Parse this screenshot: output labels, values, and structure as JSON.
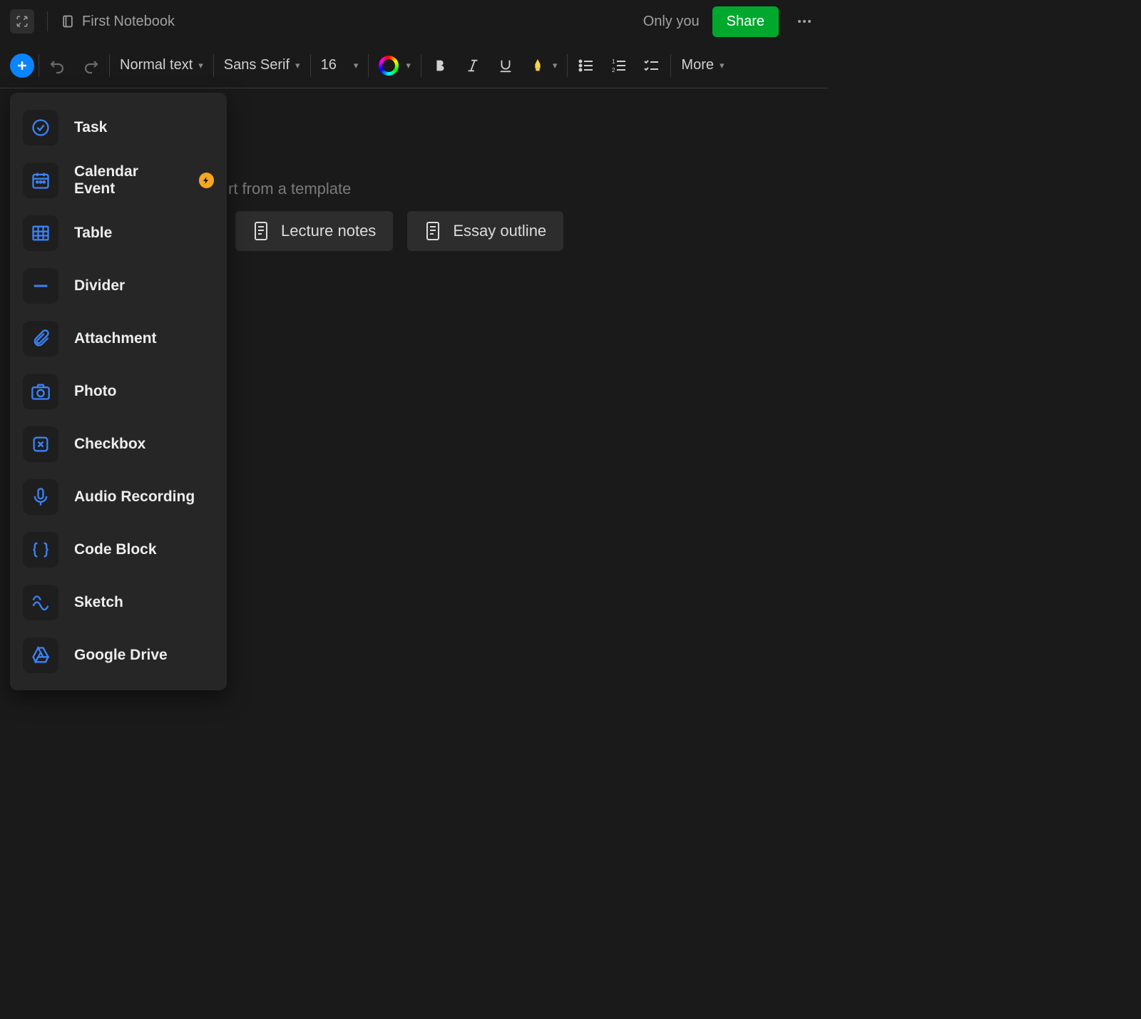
{
  "header": {
    "notebook": "First Notebook",
    "visibility": "Only you",
    "share": "Share"
  },
  "toolbar": {
    "text_style": "Normal text",
    "font_family": "Sans Serif",
    "font_size": "16",
    "more": "More"
  },
  "editor": {
    "template_hint_suffix": "rt from a template"
  },
  "templates": [
    {
      "label": "Lecture notes"
    },
    {
      "label": "Essay outline"
    }
  ],
  "insert_menu": [
    {
      "id": "task",
      "label": "Task",
      "icon": "check-circle"
    },
    {
      "id": "calendar",
      "label": "Calendar Event",
      "icon": "calendar",
      "badge": true
    },
    {
      "id": "table",
      "label": "Table",
      "icon": "table"
    },
    {
      "id": "divider",
      "label": "Divider",
      "icon": "divider"
    },
    {
      "id": "attachment",
      "label": "Attachment",
      "icon": "paperclip"
    },
    {
      "id": "photo",
      "label": "Photo",
      "icon": "camera"
    },
    {
      "id": "checkbox",
      "label": "Checkbox",
      "icon": "checkbox"
    },
    {
      "id": "audio",
      "label": "Audio Recording",
      "icon": "mic"
    },
    {
      "id": "code",
      "label": "Code Block",
      "icon": "braces"
    },
    {
      "id": "sketch",
      "label": "Sketch",
      "icon": "sketch"
    },
    {
      "id": "gdrive",
      "label": "Google Drive",
      "icon": "gdrive"
    }
  ],
  "colors": {
    "accent": "#0a84ff",
    "share": "#00a82d",
    "icon_blue": "#3b82f6"
  }
}
